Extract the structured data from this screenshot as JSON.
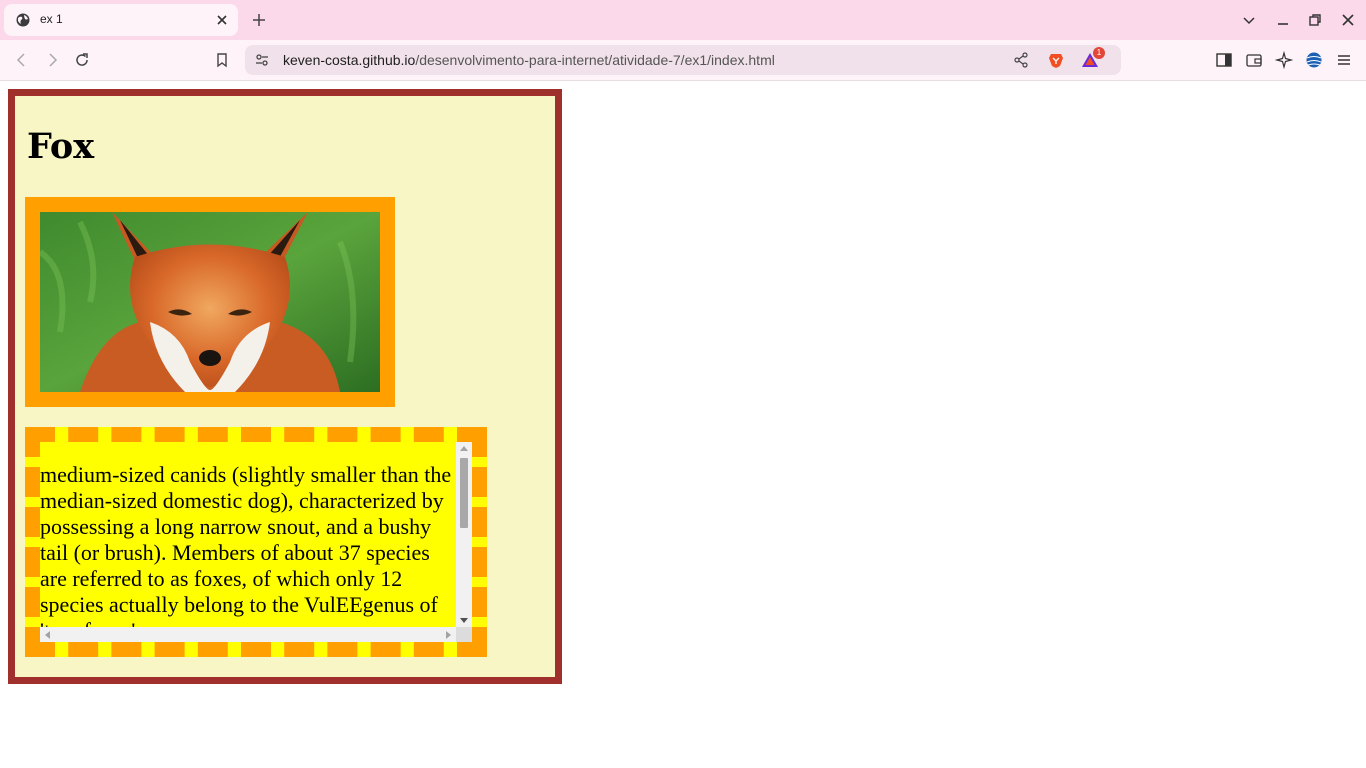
{
  "browser": {
    "tab_title": "ex 1",
    "url_host": "keven-costa.github.io",
    "url_path": "/desenvolvimento-para-internet/atividade-7/ex1/index.html",
    "rewards_badge": "1",
    "icons": {
      "tab_favicon": "globe-icon",
      "tab_close": "close-icon",
      "new_tab": "plus-icon",
      "tab_search": "chevron-down-icon",
      "minimize": "minimize-icon",
      "restore": "restore-icon",
      "close_window": "close-icon",
      "back": "back-arrow-icon",
      "forward": "forward-arrow-icon",
      "reload": "reload-icon",
      "bookmark": "bookmark-icon",
      "site_info": "site-settings-icon",
      "share": "share-icon",
      "brave_shields": "brave-lion-icon",
      "brave_rewards": "rewards-triangle-icon",
      "sidebar": "sidebar-icon",
      "wallet": "wallet-icon",
      "leo_ai": "sparkle-icon",
      "vpn": "vpn-globe-icon",
      "menu": "hamburger-menu-icon"
    }
  },
  "page": {
    "heading": "Fox",
    "image_alt": "fox photo",
    "paragraph": "medium-sized canids (slightly smaller than the median-sized domestic dog), characterized by possessing a long narrow snout, and a bushy tail (or brush). Members of about 37 species are referred to as foxes, of which only 12 species actually belong to the VulEEgenus of 'true foxes'.",
    "colors": {
      "card_border": "#a0302c",
      "card_background": "#f8f6c4",
      "image_frame": "#ffa000",
      "text_background": "#ffff00",
      "text_border": "#ffa000",
      "tabbar": "#fbd9ea"
    }
  }
}
